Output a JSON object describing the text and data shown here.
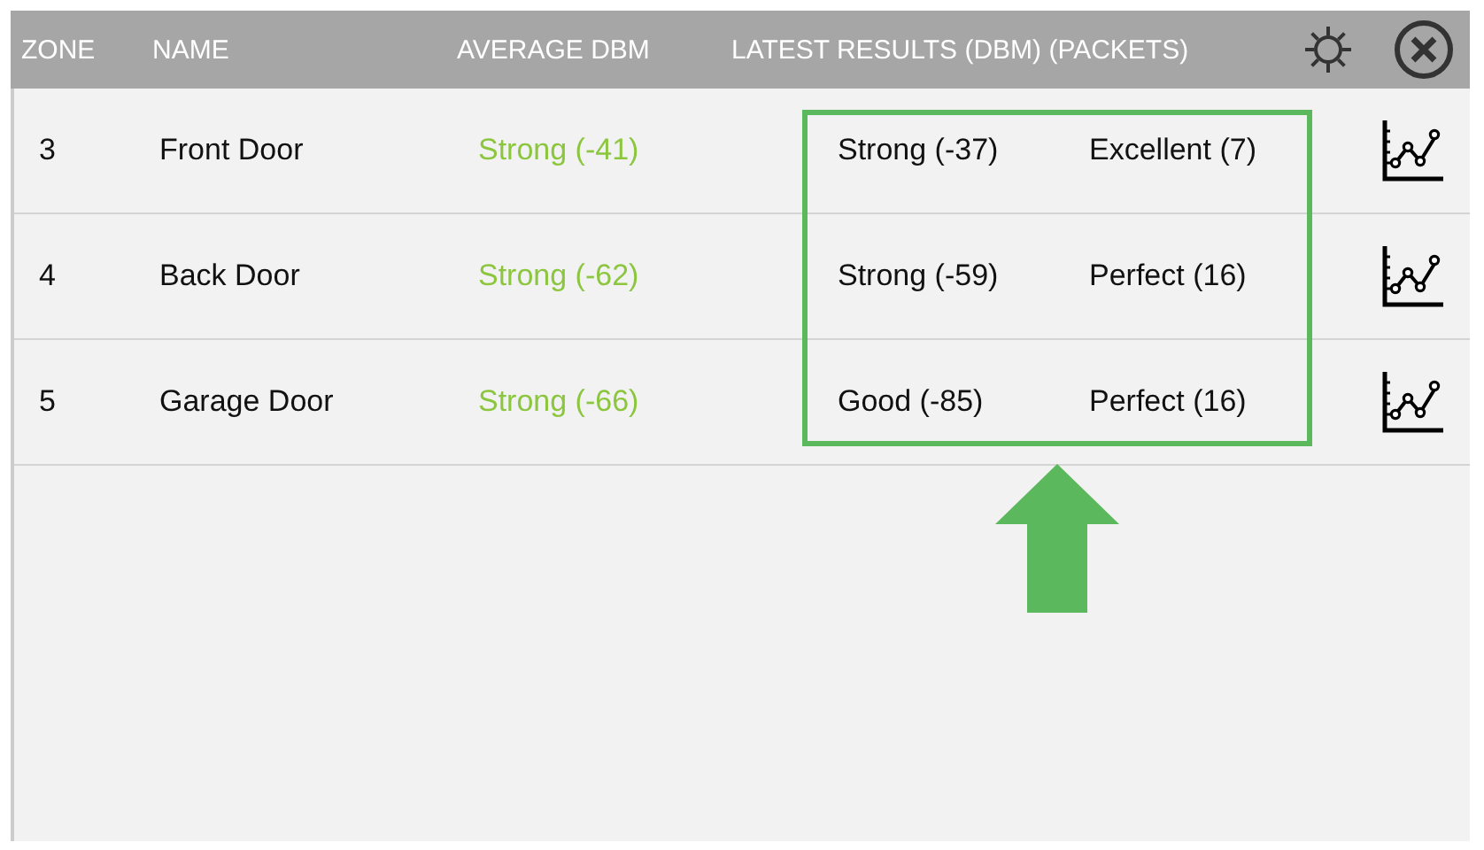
{
  "header": {
    "columns": [
      "ZONE",
      "NAME",
      "AVERAGE DBM",
      "LATEST RESULTS (DBM) (PACKETS)"
    ]
  },
  "rows": [
    {
      "zone": "3",
      "name": "Front Door",
      "average": "Strong (-41)",
      "latest_dbm": "Strong (-37)",
      "latest_packets": "Excellent (7)"
    },
    {
      "zone": "4",
      "name": "Back Door",
      "average": "Strong (-62)",
      "latest_dbm": "Strong (-59)",
      "latest_packets": "Perfect (16)"
    },
    {
      "zone": "5",
      "name": "Garage Door",
      "average": "Strong (-66)",
      "latest_dbm": "Good (-85)",
      "latest_packets": "Perfect (16)"
    }
  ]
}
